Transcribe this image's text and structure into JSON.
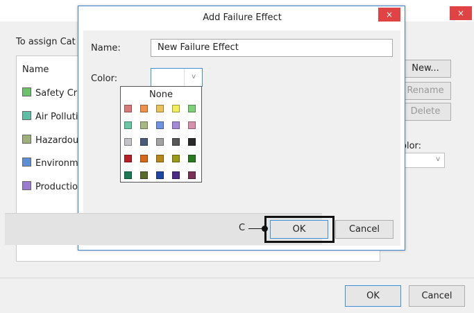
{
  "background_dialog": {
    "close_glyph": "×",
    "instruction": "To assign Cat",
    "list_header": "Name",
    "categories": [
      {
        "label": "Safety Crit",
        "color": "#6bc26b"
      },
      {
        "label": "Air Polluti",
        "color": "#5fbfa5"
      },
      {
        "label": "Hazardou",
        "color": "#9fb07a"
      },
      {
        "label": "Environme",
        "color": "#5b8fd8"
      },
      {
        "label": "Productio",
        "color": "#9a7bd0"
      }
    ],
    "buttons": {
      "new": "New...",
      "rename": "Rename",
      "delete": "Delete"
    },
    "color_label": "olor:",
    "color_select_chevron": "v",
    "ok": "OK",
    "cancel": "Cancel"
  },
  "dialog": {
    "title": "Add Failure Effect",
    "close_glyph": "×",
    "name_label": "Name:",
    "name_value": "New Failure Effect",
    "color_label": "Color:",
    "color_select_chevron": "v",
    "palette": {
      "none_label": "None",
      "rows": [
        [
          "#d97a7a",
          "#f0914a",
          "#e8c25a",
          "#f3ef5a",
          "#7fd07a"
        ],
        [
          "#6cc7a7",
          "#a7b883",
          "#6f93e0",
          "#a38ad8",
          "#d790ad"
        ],
        [
          "#c4c4c8",
          "#4a5a7a",
          "#a3a3a3",
          "#575757",
          "#2a2a2a"
        ],
        [
          "#b51f25",
          "#d86718",
          "#b8871a",
          "#9a9a14",
          "#2a7a1f"
        ],
        [
          "#1e7a56",
          "#5a6a2a",
          "#1e47a5",
          "#4b2a8a",
          "#7a3058"
        ]
      ]
    },
    "ok": "OK",
    "cancel": "Cancel"
  },
  "callout": {
    "label": "C"
  }
}
